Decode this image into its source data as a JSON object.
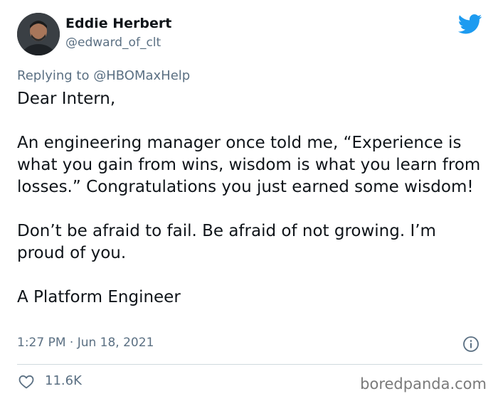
{
  "author": {
    "display_name": "Eddie Herbert",
    "handle": "@edward_of_clt",
    "avatar_icon": "profile-photo"
  },
  "reply": {
    "prefix": "Replying to",
    "mention": "@HBOMaxHelp"
  },
  "tweet": {
    "paragraphs": [
      "Dear Intern,",
      "An engineering manager once told me, “Experience is what you gain from wins, wisdom is what you learn from losses.” Congratulations you just earned some wisdom!",
      "Don’t be afraid to fail. Be afraid of not growing. I’m proud of you.",
      "A Platform Engineer"
    ]
  },
  "meta": {
    "timestamp": "1:27 PM · Jun 18, 2021",
    "likes": "11.6K"
  },
  "icons": {
    "brand": "twitter-bird-icon",
    "info": "info-icon",
    "like": "heart-icon"
  },
  "colors": {
    "twitter_blue": "#1d9bf0",
    "secondary_text": "#5b7083"
  },
  "watermark": "boredpanda.com"
}
